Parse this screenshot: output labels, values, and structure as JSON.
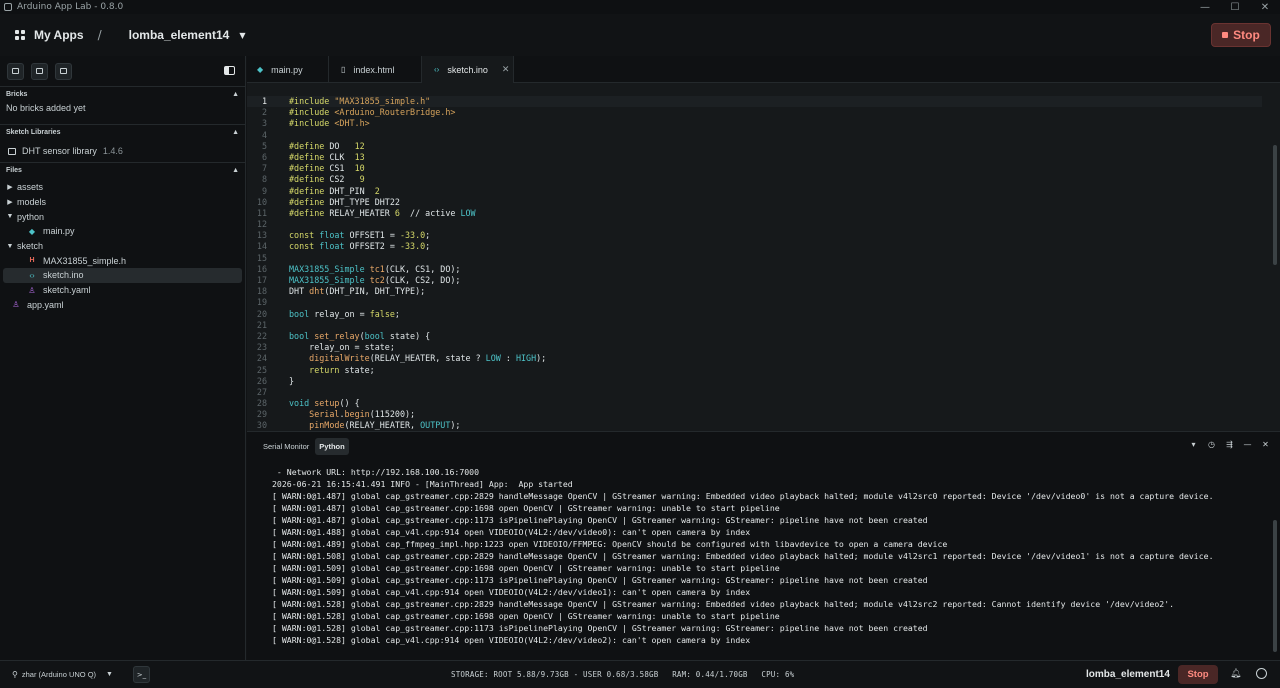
{
  "window": {
    "title": "Arduino App Lab - 0.8.0",
    "controls": [
      "—",
      "☐",
      "✕"
    ]
  },
  "header": {
    "my_apps": "My Apps",
    "separator": "/",
    "app_name": "lomba_element14",
    "stop_label": "Stop"
  },
  "sidebar": {
    "bricks": {
      "title": "Bricks",
      "empty": "No bricks added yet"
    },
    "libraries": {
      "title": "Sketch Libraries",
      "items": [
        {
          "name": "DHT sensor library",
          "version": "1.4.6"
        }
      ]
    },
    "files": {
      "title": "Files",
      "tree": [
        {
          "label": "assets",
          "type": "folder",
          "depth": 0,
          "expanded": false
        },
        {
          "label": "models",
          "type": "folder",
          "depth": 0,
          "expanded": false
        },
        {
          "label": "python",
          "type": "folder",
          "depth": 0,
          "expanded": true
        },
        {
          "label": "main.py",
          "type": "py",
          "depth": 1
        },
        {
          "label": "sketch",
          "type": "folder",
          "depth": 0,
          "expanded": true
        },
        {
          "label": "MAX31855_simple.h",
          "type": "h",
          "depth": 1
        },
        {
          "label": "sketch.ino",
          "type": "ino",
          "depth": 1,
          "selected": true
        },
        {
          "label": "sketch.yaml",
          "type": "yaml",
          "depth": 1
        },
        {
          "label": "app.yaml",
          "type": "yaml",
          "depth": 0
        }
      ]
    }
  },
  "tabs": [
    {
      "label": "main.py",
      "icon": "python-icon"
    },
    {
      "label": "index.html",
      "icon": "file-icon"
    },
    {
      "label": "sketch.ino",
      "icon": "code-icon",
      "active": true
    }
  ],
  "editor": {
    "current_line": 1,
    "lines": [
      [
        [
          "#include ",
          "kw-pre"
        ],
        [
          "\"MAX31855_simple.h\"",
          "str"
        ]
      ],
      [
        [
          "#include ",
          "kw-pre"
        ],
        [
          "<Arduino_RouterBridge.h>",
          "str"
        ]
      ],
      [
        [
          "#include ",
          "kw-pre"
        ],
        [
          "<DHT.h>",
          "str"
        ]
      ],
      [],
      [
        [
          "#define ",
          "kw-pre"
        ],
        [
          "DO   ",
          ""
        ],
        [
          "12",
          "num"
        ]
      ],
      [
        [
          "#define ",
          "kw-pre"
        ],
        [
          "CLK  ",
          ""
        ],
        [
          "13",
          "num"
        ]
      ],
      [
        [
          "#define ",
          "kw-pre"
        ],
        [
          "CS1  ",
          ""
        ],
        [
          "10",
          "num"
        ]
      ],
      [
        [
          "#define ",
          "kw-pre"
        ],
        [
          "CS2   ",
          ""
        ],
        [
          "9",
          "num"
        ]
      ],
      [
        [
          "#define ",
          "kw-pre"
        ],
        [
          "DHT_PIN  ",
          ""
        ],
        [
          "2",
          "num"
        ]
      ],
      [
        [
          "#define ",
          "kw-pre"
        ],
        [
          "DHT_TYPE DHT22",
          ""
        ]
      ],
      [
        [
          "#define ",
          "kw-pre"
        ],
        [
          "RELAY_HEATER ",
          ""
        ],
        [
          "6",
          "num"
        ],
        [
          "  // active ",
          ""
        ],
        [
          "LOW",
          "kw-type"
        ]
      ],
      [],
      [
        [
          "const ",
          "kw-pre"
        ],
        [
          "float ",
          "kw-type"
        ],
        [
          "OFFSET1 = ",
          ""
        ],
        [
          "-33.0",
          "num"
        ],
        [
          ";",
          ""
        ]
      ],
      [
        [
          "const ",
          "kw-pre"
        ],
        [
          "float ",
          "kw-type"
        ],
        [
          "OFFSET2 = ",
          ""
        ],
        [
          "-33.0",
          "num"
        ],
        [
          ";",
          ""
        ]
      ],
      [],
      [
        [
          "MAX31855_Simple ",
          "cls"
        ],
        [
          "tc1",
          "fn"
        ],
        [
          "(CLK, CS1, DO);",
          ""
        ]
      ],
      [
        [
          "MAX31855_Simple ",
          "cls"
        ],
        [
          "tc2",
          "fn"
        ],
        [
          "(CLK, CS2, DO);",
          ""
        ]
      ],
      [
        [
          "DHT ",
          ""
        ],
        [
          "dht",
          "fn"
        ],
        [
          "(DHT_PIN, DHT_TYPE);",
          ""
        ]
      ],
      [],
      [
        [
          "bool ",
          "kw-type"
        ],
        [
          "relay_on = ",
          ""
        ],
        [
          "false",
          "num"
        ],
        [
          ";",
          ""
        ]
      ],
      [],
      [
        [
          "bool ",
          "kw-type"
        ],
        [
          "set_relay",
          "fn"
        ],
        [
          "(",
          ""
        ],
        [
          "bool ",
          "kw-type"
        ],
        [
          "state) {",
          ""
        ]
      ],
      [
        [
          "    relay_on = state;",
          ""
        ]
      ],
      [
        [
          "    ",
          ""
        ],
        [
          "digitalWrite",
          "fn"
        ],
        [
          "(RELAY_HEATER, state ? ",
          ""
        ],
        [
          "LOW",
          "kw-type"
        ],
        [
          " : ",
          ""
        ],
        [
          "HIGH",
          "kw-type"
        ],
        [
          ");",
          ""
        ]
      ],
      [
        [
          "    ",
          ""
        ],
        [
          "return ",
          "kw-pre"
        ],
        [
          "state;",
          ""
        ]
      ],
      [
        [
          "}",
          ""
        ]
      ],
      [],
      [
        [
          "void ",
          "kw-type"
        ],
        [
          "setup",
          "fn"
        ],
        [
          "() {",
          ""
        ]
      ],
      [
        [
          "    ",
          ""
        ],
        [
          "Serial",
          "fn"
        ],
        [
          ".",
          ""
        ],
        [
          "begin",
          "fn"
        ],
        [
          "(115200);",
          ""
        ]
      ],
      [
        [
          "    ",
          ""
        ],
        [
          "pinMode",
          "fn"
        ],
        [
          "(RELAY_HEATER, ",
          ""
        ],
        [
          "OUTPUT",
          "kw-type"
        ],
        [
          ");",
          ""
        ]
      ]
    ]
  },
  "bottom_panel": {
    "tabs": [
      {
        "label": "Serial Monitor"
      },
      {
        "label": "Python",
        "active": true
      }
    ],
    "icons": [
      "▾",
      "◷",
      "⇶",
      "—",
      "✕"
    ],
    "console_lines": [
      " - Network URL: http://192.168.100.16:7000",
      "2026-06-21 16:15:41.491 INFO - [MainThread] App:  App started",
      "[ WARN:0@1.487] global cap_gstreamer.cpp:2829 handleMessage OpenCV | GStreamer warning: Embedded video playback halted; module v4l2src0 reported: Device '/dev/video0' is not a capture device.",
      "[ WARN:0@1.487] global cap_gstreamer.cpp:1698 open OpenCV | GStreamer warning: unable to start pipeline",
      "[ WARN:0@1.487] global cap_gstreamer.cpp:1173 isPipelinePlaying OpenCV | GStreamer warning: GStreamer: pipeline have not been created",
      "[ WARN:0@1.488] global cap_v4l.cpp:914 open VIDEOIO(V4L2:/dev/video0): can't open camera by index",
      "[ WARN:0@1.489] global cap_ffmpeg_impl.hpp:1223 open VIDEOIO/FFMPEG: OpenCV should be configured with libavdevice to open a camera device",
      "[ WARN:0@1.508] global cap_gstreamer.cpp:2829 handleMessage OpenCV | GStreamer warning: Embedded video playback halted; module v4l2src1 reported: Device '/dev/video1' is not a capture device.",
      "[ WARN:0@1.509] global cap_gstreamer.cpp:1698 open OpenCV | GStreamer warning: unable to start pipeline",
      "[ WARN:0@1.509] global cap_gstreamer.cpp:1173 isPipelinePlaying OpenCV | GStreamer warning: GStreamer: pipeline have not been created",
      "[ WARN:0@1.509] global cap_v4l.cpp:914 open VIDEOIO(V4L2:/dev/video1): can't open camera by index",
      "[ WARN:0@1.528] global cap_gstreamer.cpp:2829 handleMessage OpenCV | GStreamer warning: Embedded video playback halted; module v4l2src2 reported: Cannot identify device '/dev/video2'.",
      "[ WARN:0@1.528] global cap_gstreamer.cpp:1698 open OpenCV | GStreamer warning: unable to start pipeline",
      "[ WARN:0@1.528] global cap_gstreamer.cpp:1173 isPipelinePlaying OpenCV | GStreamer warning: GStreamer: pipeline have not been created",
      "[ WARN:0@1.528] global cap_v4l.cpp:914 open VIDEOIO(V4L2:/dev/video2): can't open camera by index"
    ]
  },
  "statusbar": {
    "board": "zhar (Arduino UNO Q)",
    "terminal_glyph": ">_",
    "storage": "STORAGE: ROOT 5.88/9.73GB - USER 0.68/3.58GB",
    "ram": "RAM: 0.44/1.70GB",
    "cpu": "CPU: 6%",
    "app_name": "lomba_element14",
    "stop_label": "Stop"
  }
}
